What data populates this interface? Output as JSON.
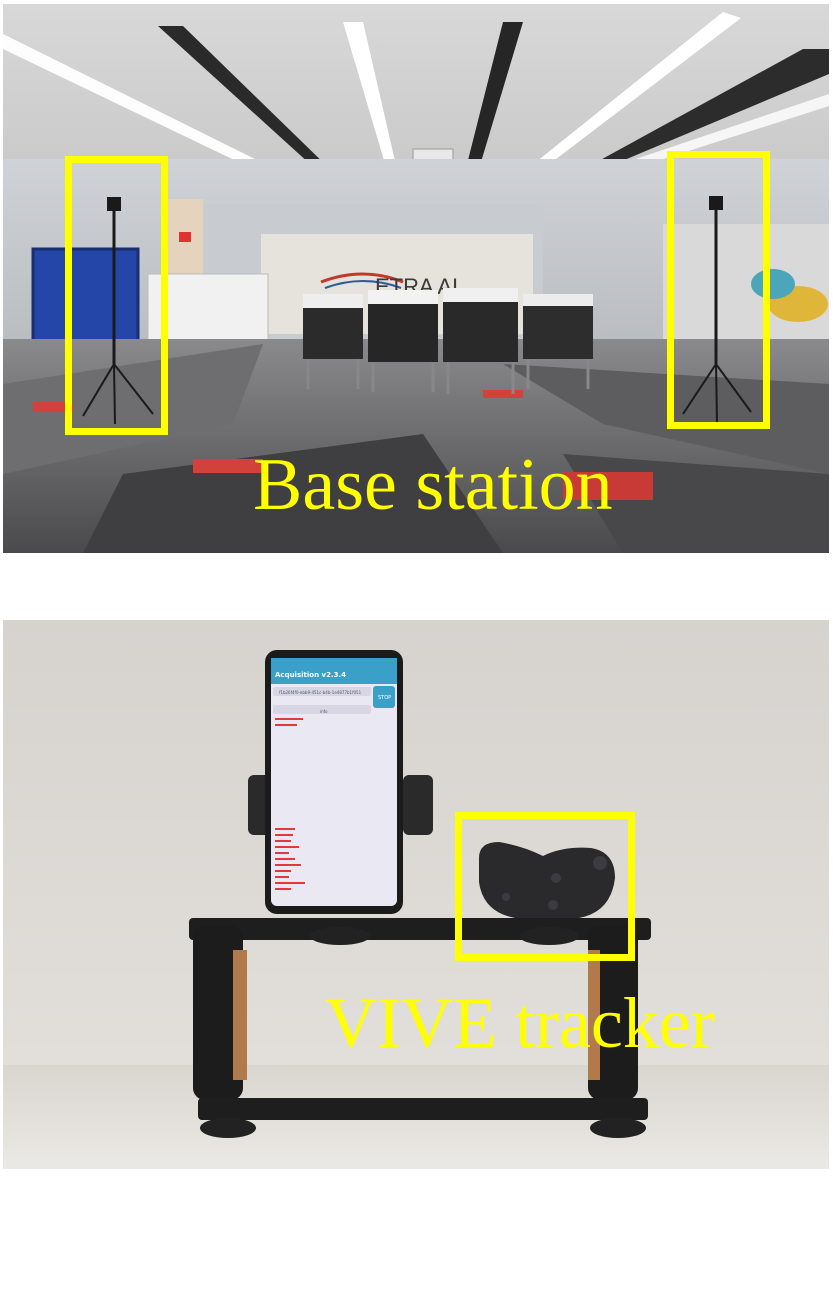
{
  "top_panel": {
    "caption": "Base station",
    "wall_logo": "ETRA AI",
    "highlight_color": "#ffff00"
  },
  "bottom_panel": {
    "caption": "VIVE tracker",
    "phone": {
      "app_title": "Acquisition v2.3.4",
      "uuid_text": "f1b26f4f0-ebb9-451c-b4b-1e4877b1f051",
      "info_label": "info",
      "stop_label": "STOP"
    },
    "highlight_color": "#ffff00"
  }
}
